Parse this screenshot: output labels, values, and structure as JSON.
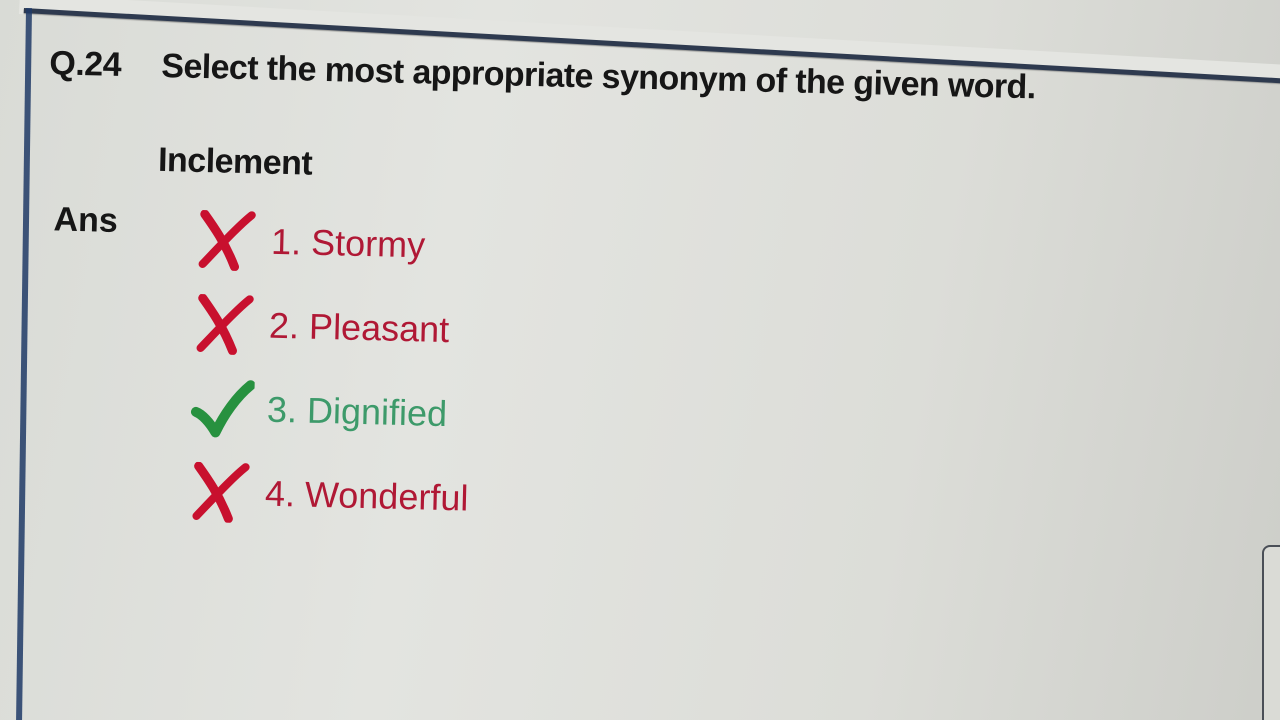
{
  "question": {
    "number": "Q.24",
    "text": "Select the most appropriate synonym of the given word.",
    "word": "Inclement"
  },
  "answer": {
    "label": "Ans",
    "options": [
      {
        "text": "1. Stormy",
        "status": "wrong",
        "icon": "cross-icon"
      },
      {
        "text": "2. Pleasant",
        "status": "wrong",
        "icon": "cross-icon"
      },
      {
        "text": "3. Dignified",
        "status": "correct",
        "icon": "check-icon"
      },
      {
        "text": "4. Wonderful",
        "status": "wrong",
        "icon": "cross-icon"
      }
    ]
  },
  "colors": {
    "wrong": "#b01835",
    "correct": "#3d9a6a",
    "check_mark": "#27913f",
    "cross_mark": "#c8102e",
    "frame": "#2e3a4f"
  }
}
